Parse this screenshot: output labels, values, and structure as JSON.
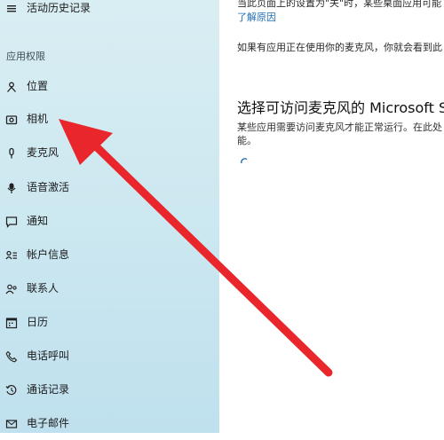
{
  "sidebar": {
    "top_item": {
      "label": "活动历史记录",
      "icon": "history-icon"
    },
    "section_title": "应用权限",
    "items": [
      {
        "label": "位置",
        "icon": "location-icon"
      },
      {
        "label": "相机",
        "icon": "camera-icon"
      },
      {
        "label": "麦克风",
        "icon": "microphone-icon"
      },
      {
        "label": "语音激活",
        "icon": "voice-activation-icon"
      },
      {
        "label": "通知",
        "icon": "notification-icon"
      },
      {
        "label": "帐户信息",
        "icon": "account-info-icon"
      },
      {
        "label": "联系人",
        "icon": "contacts-icon"
      },
      {
        "label": "日历",
        "icon": "calendar-icon"
      },
      {
        "label": "电话呼叫",
        "icon": "phone-icon"
      },
      {
        "label": "通话记录",
        "icon": "call-history-icon"
      },
      {
        "label": "电子邮件",
        "icon": "email-icon"
      }
    ]
  },
  "main": {
    "top_text_partial": "当此页面上的设置为\"关\"时，某些桌面应用可能",
    "learn_why_link": "了解原因",
    "in_use_text": "如果有应用正在使用你的麦克风，你就会看到此",
    "heading": "选择可访问麦克风的 Microsoft St",
    "desc_line1": "某些应用需要访问麦克风才能正常运行。在此处",
    "desc_line2": "能。"
  },
  "colors": {
    "sidebar_bg": "#cbe7f0",
    "link": "#1f6fb3",
    "arrow": "#e8262b"
  }
}
